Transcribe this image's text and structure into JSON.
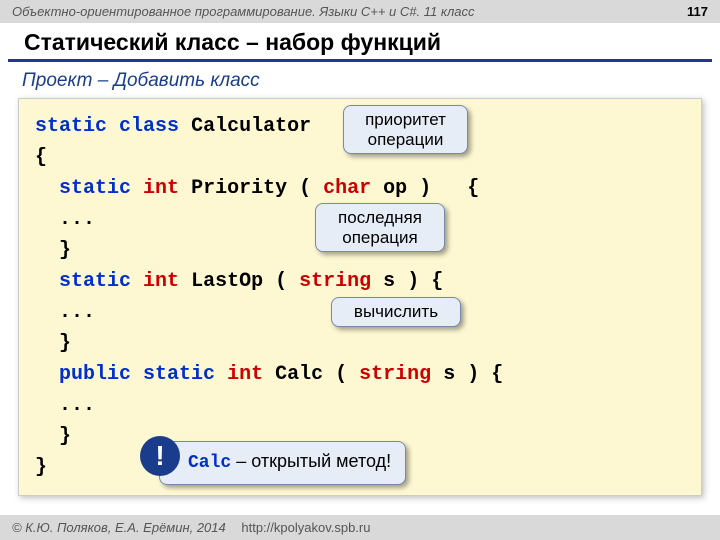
{
  "header": {
    "course": "Объектно-ориентированное программирование. Языки C++ и C#. 11 класс",
    "page": "117"
  },
  "title": "Статический класс – набор функций",
  "subtitle": "Проект – Добавить класс",
  "code": {
    "l1_kw1": "static",
    "l1_kw2": "class",
    "l1_name": "Calculator",
    "brace_open": "{",
    "l2_kw1": "static",
    "l2_type": "int",
    "l2_name": "Priority",
    "l2_paren1": "(",
    "l2_argkw": "char",
    "l2_arg": "op",
    "l2_paren2": ")",
    "l2_brace": "{",
    "dots": "...",
    "brace_close": "}",
    "l3_kw1": "static",
    "l3_type": "int",
    "l3_name": "LastOp",
    "l3_paren1": "(",
    "l3_argkw": "string",
    "l3_arg": "s",
    "l3_paren2": ")",
    "l3_brace": "{",
    "l4_kw0": "public",
    "l4_kw1": "static",
    "l4_type": "int",
    "l4_name": "Calc",
    "l4_paren1": "(",
    "l4_argkw": "string",
    "l4_arg": "s",
    "l4_paren2": ")",
    "l4_brace": "{"
  },
  "callouts": {
    "c1": "приоритет операции",
    "c2": "последняя операция",
    "c3": "вычислить"
  },
  "note": {
    "calc": "Calc",
    "rest": " – открытый метод!"
  },
  "bang": "!",
  "footer": {
    "authors": "© К.Ю. Поляков, Е.А. Ерёмин, 2014",
    "url": "http://kpolyakov.spb.ru"
  }
}
